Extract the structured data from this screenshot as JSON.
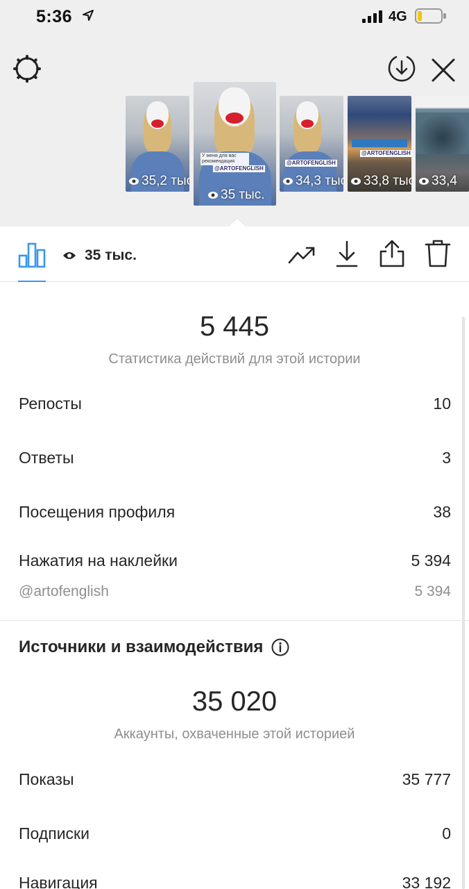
{
  "status_bar": {
    "time": "5:36",
    "network": "4G",
    "location_icon": "location-arrow-icon",
    "signal_icon": "signal-bars-icon",
    "battery_icon": "battery-icon",
    "battery_level": 0.2,
    "battery_color": "#f5c400"
  },
  "header": {
    "settings_icon": "gear-icon",
    "download_all_icon": "download-circle-icon",
    "close_icon": "close-icon",
    "thumbnails": [
      {
        "views": "35,2 тыс.",
        "selected": false
      },
      {
        "views": "35 тыс.",
        "selected": true,
        "tag": "@ARTOFENGLISH",
        "caption": "У меня для вас рекомендация"
      },
      {
        "views": "34,3 тыс.",
        "selected": false,
        "tag": "@ARTOFENGLISH"
      },
      {
        "views": "33,8 тыс.",
        "selected": false,
        "tag": "@ARTOFENGLISH"
      },
      {
        "views": "33,4",
        "selected": false
      }
    ]
  },
  "toolbar": {
    "insights_icon": "bar-chart-icon",
    "views_icon": "eye-icon",
    "views": "35 тыс.",
    "promote_icon": "trending-up-icon",
    "download_icon": "download-icon",
    "share_icon": "share-icon",
    "delete_icon": "trash-icon",
    "accent_color": "#3897f0"
  },
  "interactions": {
    "total": "5 445",
    "subtitle": "Статистика действий для этой истории",
    "rows": [
      {
        "label": "Репосты",
        "value": "10"
      },
      {
        "label": "Ответы",
        "value": "3"
      },
      {
        "label": "Посещения профиля",
        "value": "38"
      },
      {
        "label": "Нажатия на наклейки",
        "value": "5 394"
      }
    ],
    "sticker_row": {
      "label": "@artofenglish",
      "value": "5 394"
    }
  },
  "discovery": {
    "title": "Источники и взаимодействия",
    "info_icon": "info-icon",
    "total": "35 020",
    "subtitle": "Аккаунты, охваченные этой историей",
    "rows": [
      {
        "label": "Показы",
        "value": "35 777"
      },
      {
        "label": "Подписки",
        "value": "0"
      },
      {
        "label": "Навигация",
        "value": "33 192"
      }
    ]
  }
}
